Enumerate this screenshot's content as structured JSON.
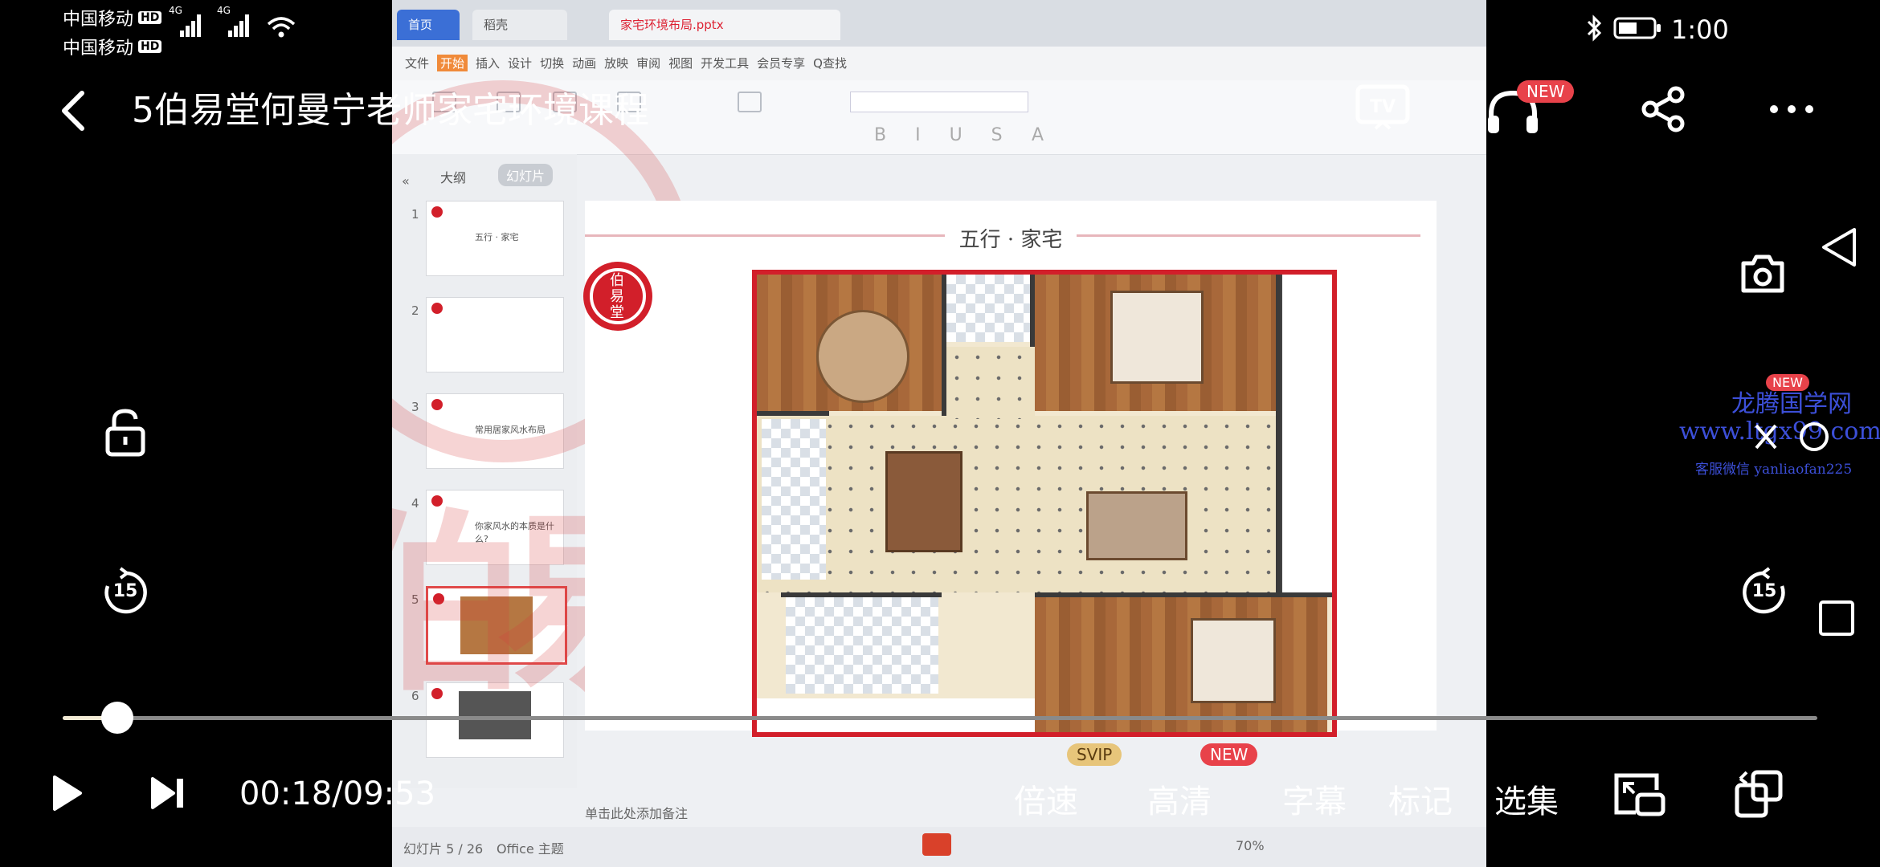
{
  "status": {
    "carrier_1": "中国移动",
    "carrier_2": "中国移动",
    "hd_1": "HD",
    "hd_2": "HD",
    "net_1": "4G",
    "net_2": "4G",
    "time": "1:00"
  },
  "header": {
    "title": "5伯易堂何曼宁老师家宅环境课程",
    "headphone_badge": "NEW"
  },
  "video": {
    "slide_title": "五行 · 家宅",
    "wps_menu": [
      "文件",
      "开始",
      "插入",
      "设计",
      "切换",
      "动画",
      "放映",
      "审阅",
      "视图",
      "开发工具",
      "会员专享",
      "Q查找"
    ],
    "panel_tabs": [
      "大纲",
      "幻灯片"
    ],
    "thumbnails": [
      "1",
      "2",
      "3",
      "4",
      "5",
      "6"
    ],
    "thumb_texts": [
      "五行 · 家宅",
      "",
      "常用居家风水布局",
      "你家风水的本质是什么?",
      "",
      ""
    ],
    "notes_hint": "单击此处添加备注",
    "status_left": "幻灯片 5 / 26",
    "status_theme": "Office 主题",
    "zoom": "70%"
  },
  "watermark": {
    "site": "龙腾国学网",
    "url": "www.ltgx99.com",
    "contact": "客服微信 yanliaofan225",
    "badge": "NEW"
  },
  "player": {
    "progress_fraction": 0.031,
    "time": "00:18/09:53",
    "replay_back": "15",
    "skip_forward": "15",
    "controls": [
      {
        "label": "倍速",
        "badge": "SVIP"
      },
      {
        "label": "高清",
        "badge": "NEW"
      },
      {
        "label": "字幕",
        "badge": ""
      },
      {
        "label": "标记",
        "badge": ""
      },
      {
        "label": "选集",
        "badge": ""
      }
    ]
  },
  "colors": {
    "accent_red": "#d21f2a",
    "progress_played": "#f2ead4",
    "svip_badge": "#e7c57a",
    "new_badge": "#e8424a"
  }
}
